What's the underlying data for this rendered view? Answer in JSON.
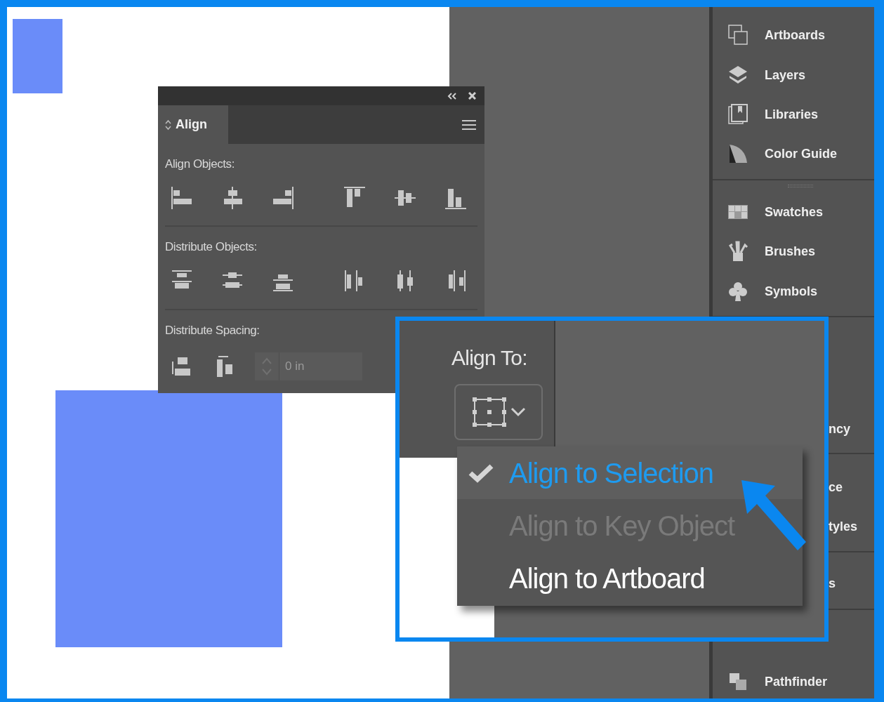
{
  "align_panel": {
    "tab": "Align",
    "sections": [
      {
        "label": "Align Objects:"
      },
      {
        "label": "Distribute Objects:"
      },
      {
        "label": "Distribute Spacing:"
      }
    ],
    "spacing_field": {
      "value": "0 in",
      "disabled": true
    }
  },
  "right_panel": {
    "groups": [
      [
        {
          "label": "Artboards",
          "kind": "full"
        },
        {
          "label": "Layers",
          "kind": "full"
        },
        {
          "label": "Libraries",
          "kind": "full"
        },
        {
          "label": "Color Guide",
          "kind": "full"
        }
      ],
      [
        {
          "label": "Swatches",
          "kind": "full"
        },
        {
          "label": "Brushes",
          "kind": "full"
        },
        {
          "label": "Symbols",
          "kind": "full"
        }
      ],
      [
        {
          "label": "ncy",
          "kind": "cut"
        }
      ],
      [
        {
          "label": "ce",
          "kind": "cut"
        },
        {
          "label": "tyles",
          "kind": "cut"
        }
      ],
      [
        {
          "label": "s",
          "kind": "cut"
        }
      ],
      [
        {
          "label": "Pathfinder",
          "kind": "full"
        }
      ]
    ]
  },
  "callout": {
    "label": "Align To:",
    "menu": [
      {
        "label": "Align to Selection",
        "selected": true,
        "disabled": false
      },
      {
        "label": "Align to Key Object",
        "selected": false,
        "disabled": true
      },
      {
        "label": "Align to Artboard",
        "selected": false,
        "disabled": false
      }
    ]
  }
}
